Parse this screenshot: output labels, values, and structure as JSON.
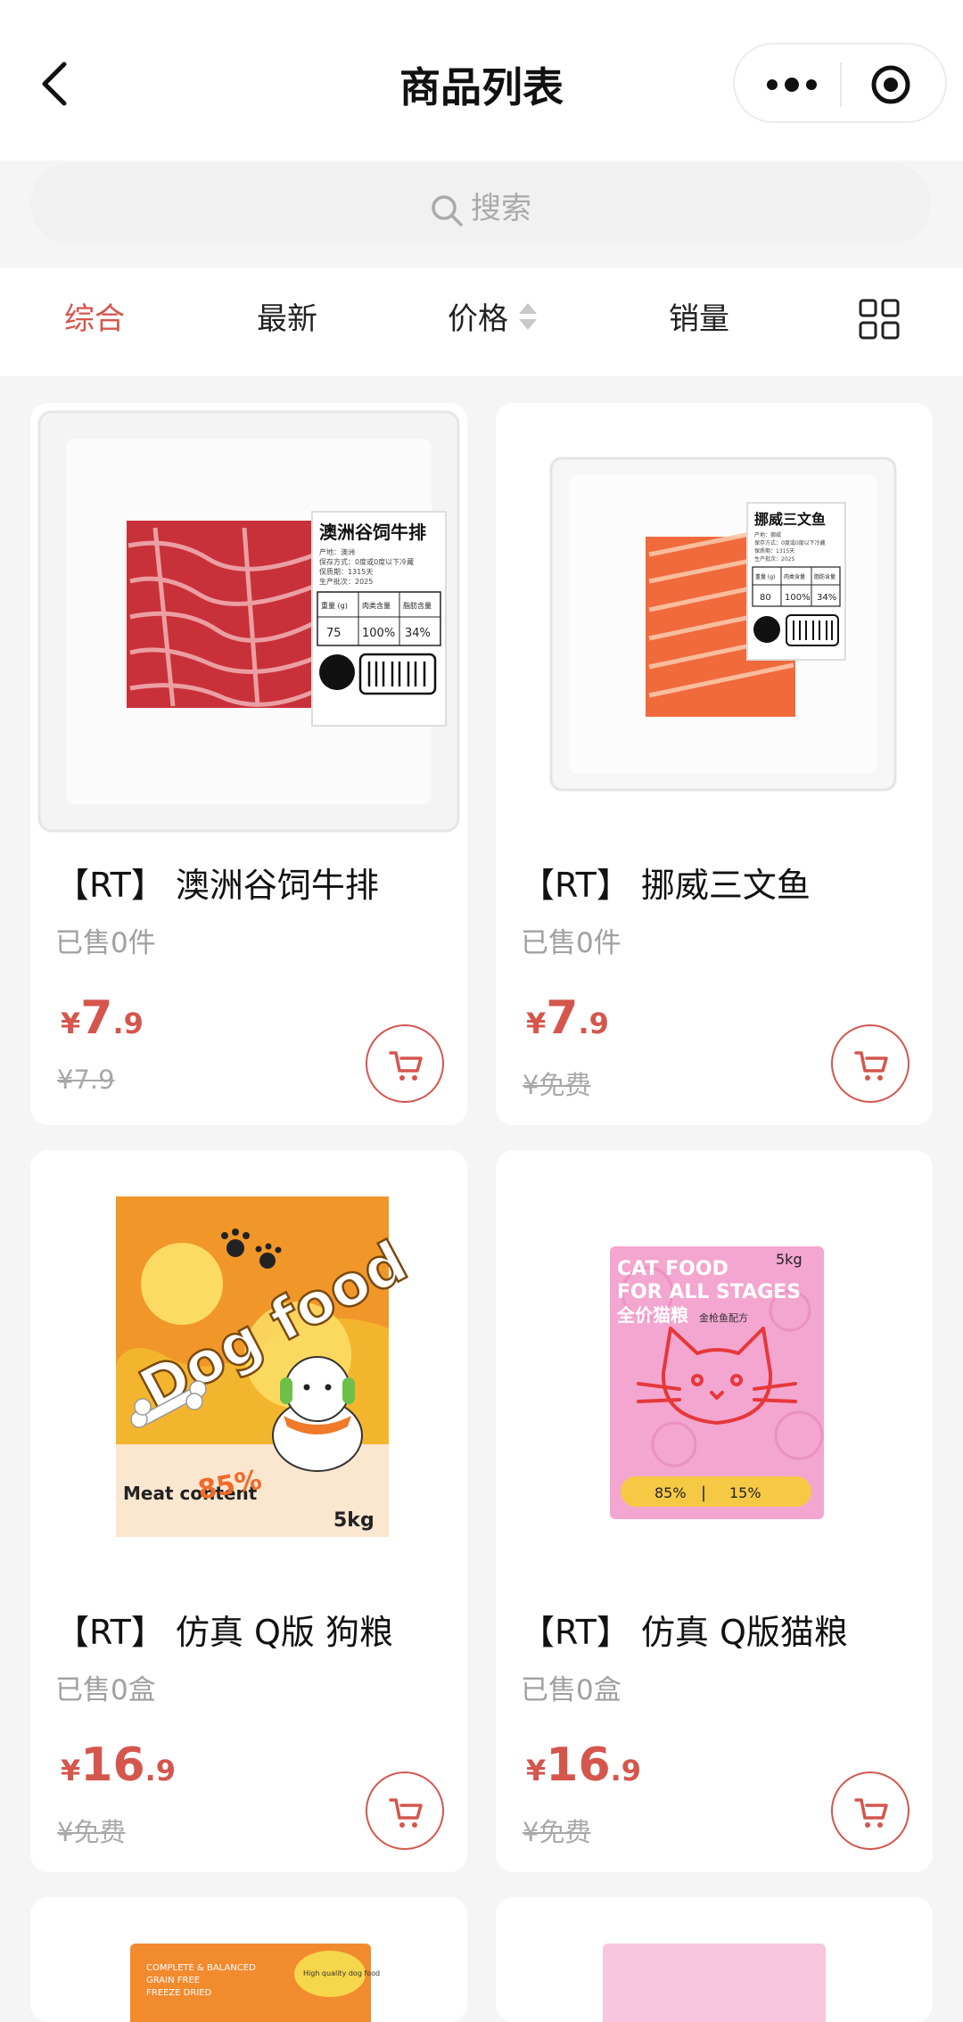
{
  "header": {
    "title": "商品列表"
  },
  "search": {
    "placeholder": "搜索"
  },
  "sort_tabs": [
    {
      "label": "综合",
      "active": true
    },
    {
      "label": "最新"
    },
    {
      "label": "价格"
    },
    {
      "label": "销量"
    }
  ],
  "colors": {
    "accent": "#d4564d",
    "muted": "#a0a0a0"
  },
  "products": [
    {
      "name": "【RT】 澳洲谷饲牛排",
      "sold": "已售0件",
      "currency": "¥",
      "price_int": "7",
      "price_dec": ".9",
      "original": "¥7.9",
      "label_title": "澳洲谷饲牛排",
      "label_lines": [
        "产地：澳洲",
        "保存方式：0度或0度以下冷藏",
        "保质期：1315天",
        "生产批次：2025"
      ],
      "label_table": [
        "重量 (g)",
        "肉类含量",
        "脂肪含量",
        "75",
        "100%",
        "34%"
      ]
    },
    {
      "name": "【RT】 挪威三文鱼",
      "sold": "已售0件",
      "currency": "¥",
      "price_int": "7",
      "price_dec": ".9",
      "original": "¥免费",
      "label_title": "挪威三文鱼",
      "label_lines": [
        "产地：挪威",
        "保存方式：0度或0度以下冷藏",
        "保质期：1315天",
        "生产批次：2025"
      ],
      "label_table": [
        "重量 (g)",
        "肉类含量",
        "脂肪含量",
        "80",
        "100%",
        "34%"
      ]
    },
    {
      "name": "【RT】 仿真 Q版 狗粮",
      "sold": "已售0盒",
      "currency": "¥",
      "price_int": "16",
      "price_dec": ".9",
      "original": "¥免费",
      "pkg_title": "Dog food",
      "pkg_content_label": "Meat content",
      "pkg_percent": "85%",
      "pkg_weight": "5kg"
    },
    {
      "name": "【RT】 仿真 Q版猫粮",
      "sold": "已售0盒",
      "currency": "¥",
      "price_int": "16",
      "price_dec": ".9",
      "original": "¥免费",
      "pkg_title_1": "CAT FOOD",
      "pkg_title_2": "FOR ALL STAGES",
      "pkg_cn": "全价猫粮",
      "pkg_cn_sub": "金枪鱼配方",
      "pkg_weight": "5kg",
      "pkg_stat_1": "85%",
      "pkg_stat_2": "15%"
    },
    {
      "pkg_lines": [
        "COMPLETE & BALANCED",
        "GRAIN FREE",
        "FREEZE DRIED"
      ],
      "pkg_badge": "High quality dog food"
    },
    {}
  ]
}
